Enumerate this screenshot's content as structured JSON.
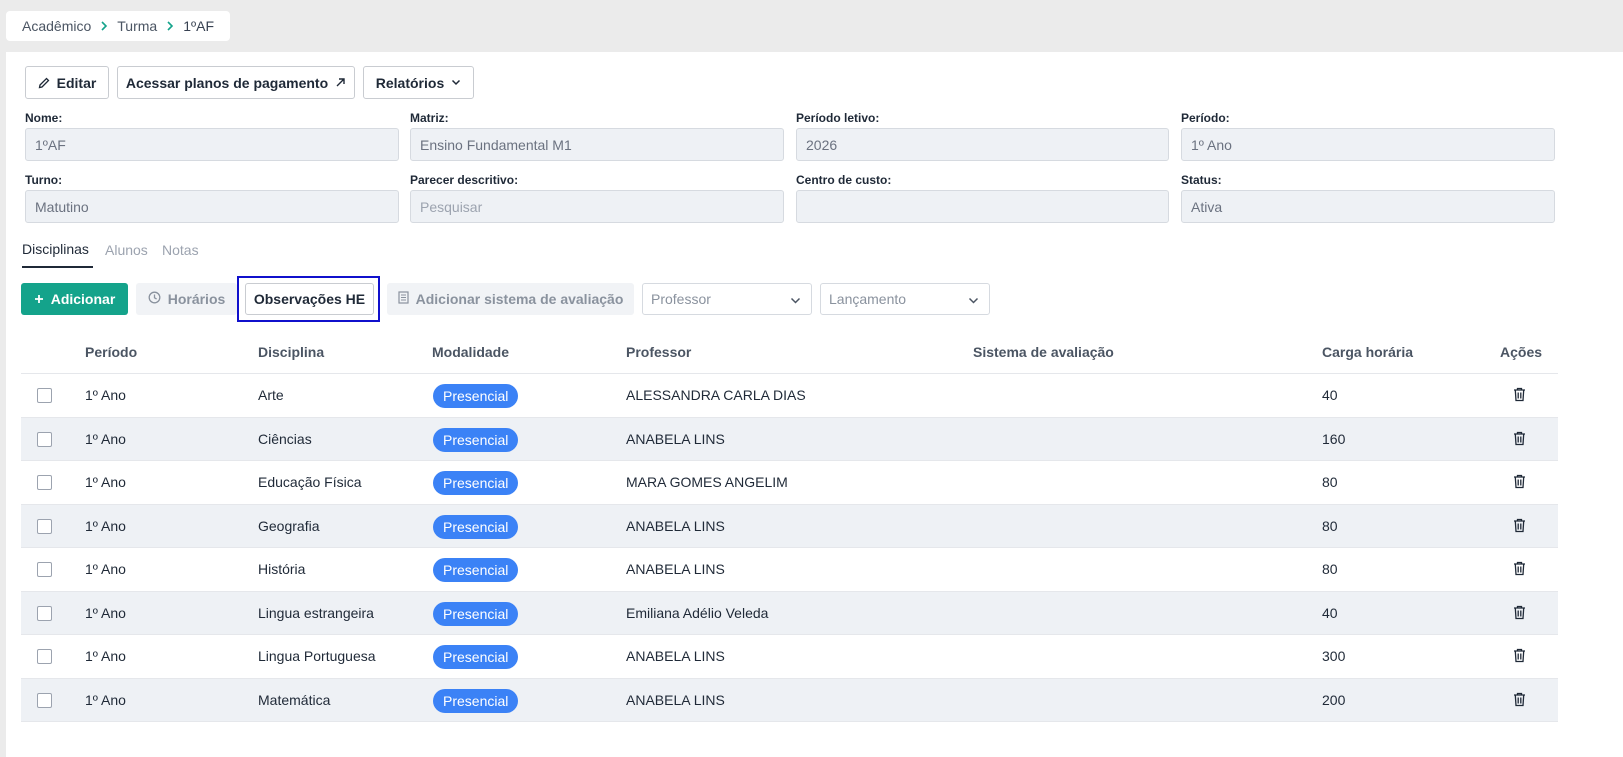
{
  "breadcrumb": {
    "items": [
      "Acadêmico",
      "Turma",
      "1ºAF"
    ]
  },
  "actions": {
    "edit": "Editar",
    "payment_plans": "Acessar planos de pagamento",
    "reports": "Relatórios"
  },
  "fields": {
    "nome": {
      "label": "Nome:",
      "value": "1ºAF"
    },
    "matriz": {
      "label": "Matriz:",
      "value": "Ensino Fundamental M1"
    },
    "periodo_letivo": {
      "label": "Período letivo:",
      "value": "2026"
    },
    "periodo": {
      "label": "Período:",
      "value": "1º Ano"
    },
    "turno": {
      "label": "Turno:",
      "value": "Matutino"
    },
    "parecer": {
      "label": "Parecer descritivo:",
      "placeholder": "Pesquisar"
    },
    "centro_custo": {
      "label": "Centro de custo:",
      "value": ""
    },
    "status": {
      "label": "Status:",
      "value": "Ativa"
    }
  },
  "tabs": [
    "Disciplinas",
    "Alunos",
    "Notas"
  ],
  "toolbar": {
    "add": "Adicionar",
    "schedules": "Horários",
    "observations": "Observações HE",
    "add_evaluation": "Adicionar sistema de avaliação",
    "professor_placeholder": "Professor",
    "launch_placeholder": "Lançamento"
  },
  "table": {
    "headers": [
      "Período",
      "Disciplina",
      "Modalidade",
      "Professor",
      "Sistema de avaliação",
      "Carga horária",
      "Ações"
    ],
    "rows": [
      {
        "periodo": "1º Ano",
        "disciplina": "Arte",
        "modalidade": "Presencial",
        "professor": "ALESSANDRA CARLA DIAS",
        "sistema": "",
        "carga": "40"
      },
      {
        "periodo": "1º Ano",
        "disciplina": "Ciências",
        "modalidade": "Presencial",
        "professor": "ANABELA LINS",
        "sistema": "",
        "carga": "160"
      },
      {
        "periodo": "1º Ano",
        "disciplina": "Educação Física",
        "modalidade": "Presencial",
        "professor": "MARA GOMES ANGELIM",
        "sistema": "",
        "carga": "80"
      },
      {
        "periodo": "1º Ano",
        "disciplina": "Geografia",
        "modalidade": "Presencial",
        "professor": "ANABELA LINS",
        "sistema": "",
        "carga": "80"
      },
      {
        "periodo": "1º Ano",
        "disciplina": "História",
        "modalidade": "Presencial",
        "professor": "ANABELA LINS",
        "sistema": "",
        "carga": "80"
      },
      {
        "periodo": "1º Ano",
        "disciplina": "Lingua estrangeira",
        "modalidade": "Presencial",
        "professor": "Emiliana Adélio Veleda",
        "sistema": "",
        "carga": "40"
      },
      {
        "periodo": "1º Ano",
        "disciplina": "Lingua Portuguesa",
        "modalidade": "Presencial",
        "professor": "ANABELA LINS",
        "sistema": "",
        "carga": "300"
      },
      {
        "periodo": "1º Ano",
        "disciplina": "Matemática",
        "modalidade": "Presencial",
        "professor": "ANABELA LINS",
        "sistema": "",
        "carga": "200"
      }
    ]
  },
  "colors": {
    "accent": "#14a38b",
    "badge": "#3b82f6",
    "highlight": "#1010cc"
  }
}
